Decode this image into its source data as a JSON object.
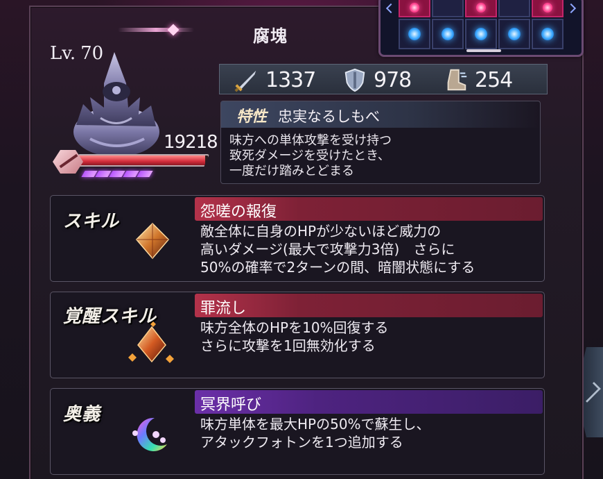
{
  "title": "腐塊",
  "unit": {
    "level_label": "Lv.",
    "level_value": "70",
    "hp": "19218",
    "hp_fraction": 0.98,
    "awaken_pips": 5
  },
  "stats": {
    "attack": "1337",
    "defense": "978",
    "speed": "254"
  },
  "trait": {
    "tag": "特性",
    "name": "忠実なるしもべ",
    "description": "味方への単体攻撃を受け持つ\n致死ダメージを受けたとき、\n一度だけ踏みとどまる"
  },
  "skills": [
    {
      "label": "スキル",
      "name": "怨嗟の報復",
      "description": "敵全体に自身のHPが少ないほど威力の\n高いダメージ(最大で攻撃力3倍)　さらに\n50%の確率で2ターンの間、暗闇状態にする",
      "color": "#b3324a"
    },
    {
      "label": "覚醒スキル",
      "name": "罪流し",
      "description": "味方全体のHPを10%回復する\nさらに攻撃を1回無効化する",
      "color": "#b3324a"
    },
    {
      "label": "奥義",
      "name": "冥界呼び",
      "description": "味方単体を最大HPの50%で蘇生し、\nアタックフォトンを1つ追加する",
      "color": "#6b2fa8"
    }
  ],
  "icons": {
    "attack": "sword-icon",
    "defense": "shield-icon",
    "speed": "boot-icon",
    "skill": "crystal-icon",
    "awaken_skill": "crystal-cluster-icon",
    "ultimate": "crescent-moon-icon"
  },
  "photons": {
    "top_row": [
      "pink",
      "empty",
      "pink",
      "empty",
      "pink"
    ],
    "bottom_row": [
      "blue",
      "blue",
      "blue",
      "blue",
      "blue"
    ]
  }
}
